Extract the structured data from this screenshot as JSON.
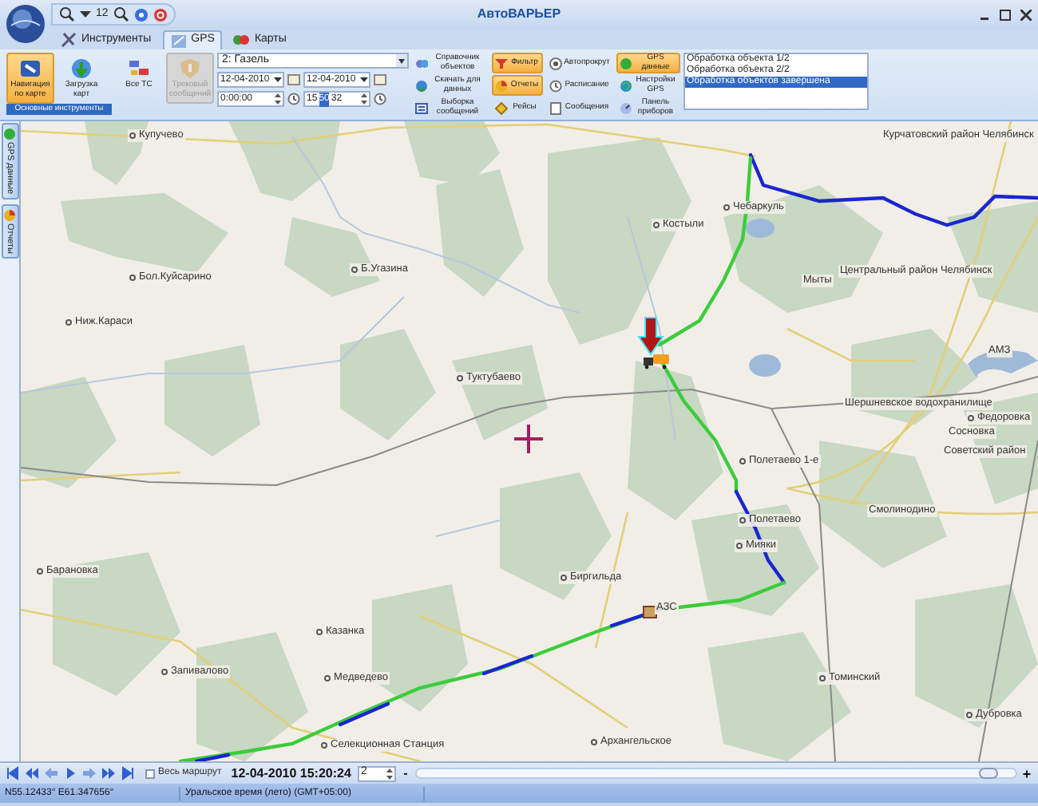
{
  "window": {
    "title": "АвтоВАРЬЕР"
  },
  "quick_access": {
    "zoom_value": "12"
  },
  "tabs": [
    {
      "label": "Инструменты",
      "selected": false
    },
    {
      "label": "GPS",
      "selected": true
    },
    {
      "label": "Карты",
      "selected": false
    }
  ],
  "ribbon": {
    "large_buttons": [
      {
        "label": "Навигация по карте",
        "active": true,
        "disabled": false
      },
      {
        "label": "Загрузка карт",
        "active": false,
        "disabled": false
      },
      {
        "label": "Все ТС",
        "active": false,
        "disabled": false
      },
      {
        "label": "Трековый сообщений",
        "active": false,
        "disabled": true
      }
    ],
    "group_label": "Основные инструменты",
    "vehicle": "2: Газель",
    "date_from": "12-04-2010",
    "date_to": "12-04-2010",
    "time_from": "0:00:00",
    "time_to": [
      {
        "text": "15",
        "selected": false
      },
      {
        "text": "50",
        "selected": true
      },
      {
        "text": "32",
        "selected": false
      }
    ],
    "button_columns": [
      [
        {
          "label": "Справочник объектов",
          "active": false
        },
        {
          "label": "Скачать для данных",
          "active": false
        },
        {
          "label": "Выборка сообщений",
          "active": false
        }
      ],
      [
        {
          "label": "Фильтр",
          "active": true
        },
        {
          "label": "Отчеты",
          "active": true
        },
        {
          "label": "Рейсы",
          "active": false
        }
      ],
      [
        {
          "label": "Автопрокрут",
          "active": false
        },
        {
          "label": "Расписание",
          "active": false
        },
        {
          "label": "Сообщения",
          "active": false
        }
      ],
      [
        {
          "label": "GPS данные",
          "active": true
        },
        {
          "label": "Настройки GPS",
          "active": false
        },
        {
          "label": "Панель приборов",
          "active": false
        }
      ]
    ],
    "log": [
      {
        "text": "Обработка объекта 1/2",
        "selected": false
      },
      {
        "text": "Обработка объекта 2/2",
        "selected": false
      },
      {
        "text": "Обработка объектов завершена",
        "selected": true
      }
    ]
  },
  "side_tabs": [
    {
      "label": "GPS данные"
    },
    {
      "label": "Отчеты"
    }
  ],
  "map": {
    "places": [
      {
        "name": "Купучево"
      },
      {
        "name": "Бол.Куйсарино"
      },
      {
        "name": "Ниж.Караси"
      },
      {
        "name": "Б.Угазина"
      },
      {
        "name": "Туктубаево"
      },
      {
        "name": "Костыли"
      },
      {
        "name": "Чебаркуль"
      },
      {
        "name": "Мыты"
      },
      {
        "name": "Курчатовский район Челябинск"
      },
      {
        "name": "Центральный район Челябинск"
      },
      {
        "name": "АМЗ"
      },
      {
        "name": "Шершневское водохранилище"
      },
      {
        "name": "Федоровка"
      },
      {
        "name": "Сосновка"
      },
      {
        "name": "Советский район"
      },
      {
        "name": "Полетаево 1-е"
      },
      {
        "name": "Полетаево"
      },
      {
        "name": "Смолинодино"
      },
      {
        "name": "Мияки"
      },
      {
        "name": "Биргильда"
      },
      {
        "name": "АЗС"
      },
      {
        "name": "Барановка"
      },
      {
        "name": "Казанка"
      },
      {
        "name": "Запивалово"
      },
      {
        "name": "Медведево"
      },
      {
        "name": "Томинский"
      },
      {
        "name": "Дубровка"
      },
      {
        "name": "Селекционная Станция"
      },
      {
        "name": "Архангельское"
      }
    ]
  },
  "playback": {
    "whole_route": {
      "label": "Весь маршрут",
      "checked": false
    },
    "timestamp": "12-04-2010 15:20:24",
    "speed": "2",
    "minus": "-",
    "plus": "+",
    "level": 0.97
  },
  "status_bar": {
    "coordinates": "N55.12433° E61.347656°",
    "timezone": "Уральское время (лето) (GMT+05:00)"
  }
}
